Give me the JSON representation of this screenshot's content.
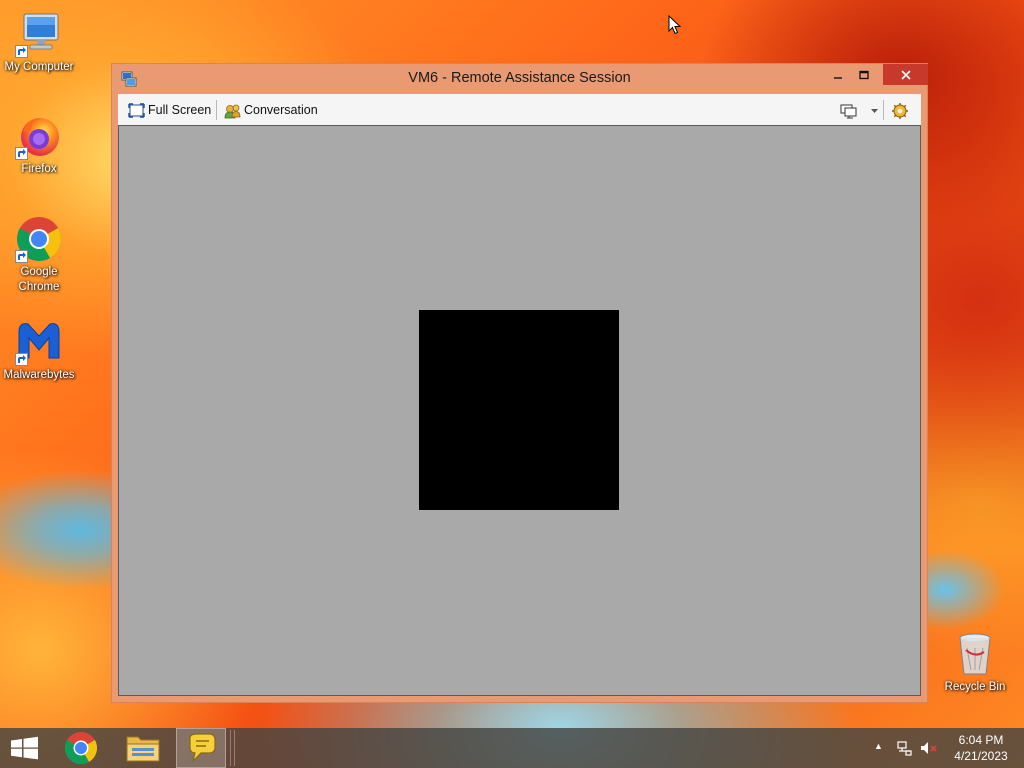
{
  "desktop": {
    "icons": [
      {
        "label": "My Computer",
        "icon": "computer-icon"
      },
      {
        "label": "Firefox",
        "icon": "firefox-icon"
      },
      {
        "label": "Google Chrome",
        "icon": "chrome-icon"
      },
      {
        "label": "Malwarebytes",
        "icon": "malwarebytes-icon"
      },
      {
        "label": "Recycle Bin",
        "icon": "recycle-bin-icon"
      }
    ]
  },
  "window": {
    "title": "VM6 - Remote Assistance Session",
    "minimize_label": "–",
    "maximize_label": "□",
    "close_label": "✕",
    "toolbar": {
      "fullscreen_label": "Full Screen",
      "conversation_label": "Conversation",
      "display_icon": "display-icon",
      "help_icon": "help-icon"
    }
  },
  "taskbar": {
    "items": [
      {
        "name": "start",
        "icon": "windows-logo-icon"
      },
      {
        "name": "chrome",
        "icon": "chrome-icon"
      },
      {
        "name": "file-explorer",
        "icon": "folder-icon"
      },
      {
        "name": "remote-assistance",
        "icon": "chat-bubble-icon",
        "active": true
      }
    ],
    "tray": {
      "chevron": "▲",
      "network_icon": "network-icon",
      "volume_icon": "volume-muted-icon"
    },
    "clock": {
      "time": "6:04 PM",
      "date": "4/21/2023"
    }
  },
  "colors": {
    "window_frame": "#e99a72",
    "close_button": "#c7392b",
    "viewport_bg": "#a9a9a9",
    "remote_screen": "#000000"
  }
}
